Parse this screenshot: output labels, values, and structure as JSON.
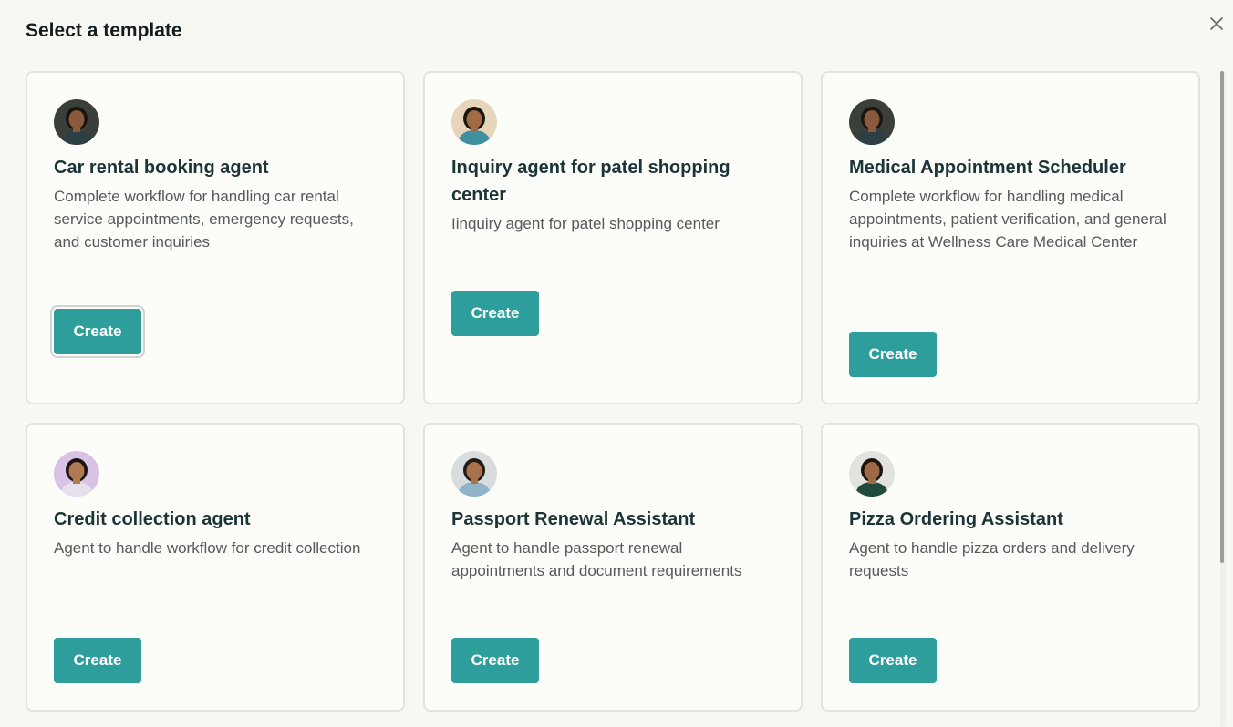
{
  "modal": {
    "title": "Select a template",
    "close_icon": "close-icon"
  },
  "templates": [
    {
      "name": "Car rental booking agent",
      "description": "Complete workflow for handling car rental service appointments, emergency requests, and customer inquiries",
      "button": "Create",
      "avatar_bg": "#3b3f3a",
      "skin": "#8a5a3c",
      "hair": "#1c1410",
      "shirt": "#2c3f45"
    },
    {
      "name": "Inquiry agent for patel shopping center",
      "description": "Iinquiry agent for patel shopping center",
      "button": "Create",
      "avatar_bg": "#e7d5bb",
      "skin": "#a36b43",
      "hair": "#1a1410",
      "shirt": "#3f8fa0"
    },
    {
      "name": "Medical Appointment Scheduler",
      "description": "Complete workflow for handling medical appointments, patient verification, and general inquiries at Wellness Care Medical Center",
      "button": "Create",
      "avatar_bg": "#3b3f3a",
      "skin": "#8a5a3c",
      "hair": "#1c1410",
      "shirt": "#2c3f45"
    },
    {
      "name": "Credit collection agent",
      "description": "Agent to handle workflow for credit collection",
      "button": "Create",
      "avatar_bg": "#d8c3e6",
      "skin": "#b07a52",
      "hair": "#1d1511",
      "shirt": "#e6e0ea"
    },
    {
      "name": "Passport Renewal Assistant",
      "description": "Agent to handle passport renewal appointments and document requirements",
      "button": "Create",
      "avatar_bg": "#d9dcdc",
      "skin": "#a8724c",
      "hair": "#231a14",
      "shirt": "#8fb4c9"
    },
    {
      "name": "Pizza Ordering Assistant",
      "description": "Agent to handle pizza orders and delivery requests",
      "button": "Create",
      "avatar_bg": "#e2e3e1",
      "skin": "#9c6a45",
      "hair": "#1b1510",
      "shirt": "#1f4a3c"
    }
  ],
  "focused_index": 0
}
